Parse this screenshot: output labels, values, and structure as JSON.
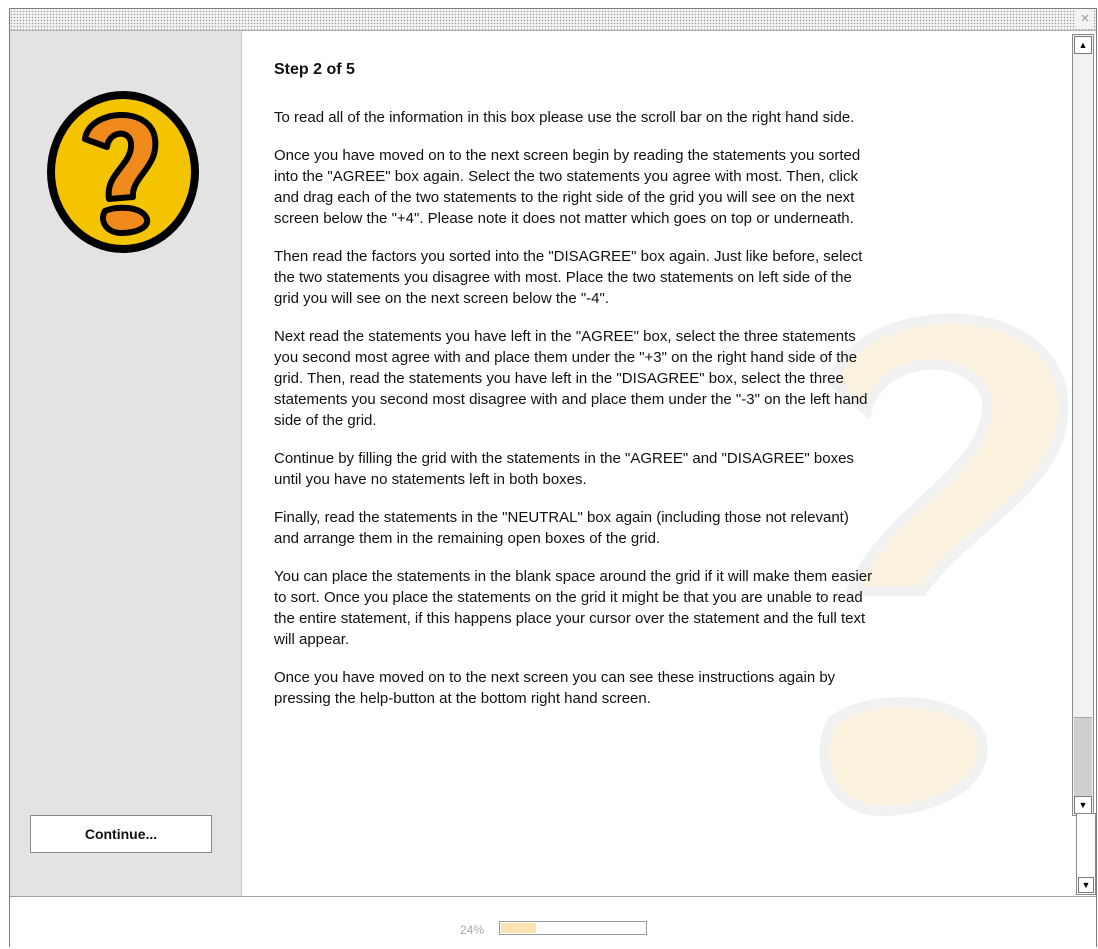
{
  "window": {
    "close_glyph": "×"
  },
  "sidebar": {
    "logo_icon": "question-mark-icon",
    "continue_label": "Continue..."
  },
  "content": {
    "title": "Step 2 of 5",
    "paragraphs": [
      "To read all of the information in this box please use the scroll bar on the right hand side.",
      "Once you have moved on to the next screen begin by reading the statements you sorted into the \"AGREE\" box again. Select the two statements you agree with most. Then, click and drag each of the two statements to the right side of the grid you will see on the next screen below the \"+4\". Please note it does not matter which goes on top or underneath.",
      "Then read the factors you sorted into the \"DISAGREE\" box again. Just like before, select the two statements you disagree with most. Place the two statements on left side of the grid you will see on the next screen below the \"-4\".",
      "Next read the statements you have left in the \"AGREE\" box, select the three statements you second most agree with and place them under the \"+3\" on the right hand side of the grid. Then, read the statements you have left in the \"DISAGREE\" box, select the three statements you second most disagree with and place them under the \"-3\" on the left hand side of the grid.",
      "Continue by filling the grid with the statements in the \"AGREE\" and \"DISAGREE\" boxes until you have no statements left in both boxes.",
      "Finally, read the statements in the \"NEUTRAL\" box again (including those not relevant) and arrange them in the remaining open boxes of the grid.",
      "You can place the statements in the blank space around the grid if it will make them easier to sort. Once you place the statements on the grid it might be that you are unable to read the entire statement, if this happens place your cursor over the statement and the full text will appear.",
      "Once you have moved on to the next screen you can see these instructions again by pressing the help-button at the bottom right hand screen."
    ]
  },
  "scrollbar": {
    "up_glyph": "▲",
    "down_glyph": "▼"
  },
  "progress": {
    "label": "24%",
    "value": 0.24
  },
  "colors": {
    "logo_fill": "#f5c400",
    "logo_mark": "#f08a1c",
    "progress_fill": "#fde2b0",
    "sidebar_bg": "#e3e3e3"
  }
}
